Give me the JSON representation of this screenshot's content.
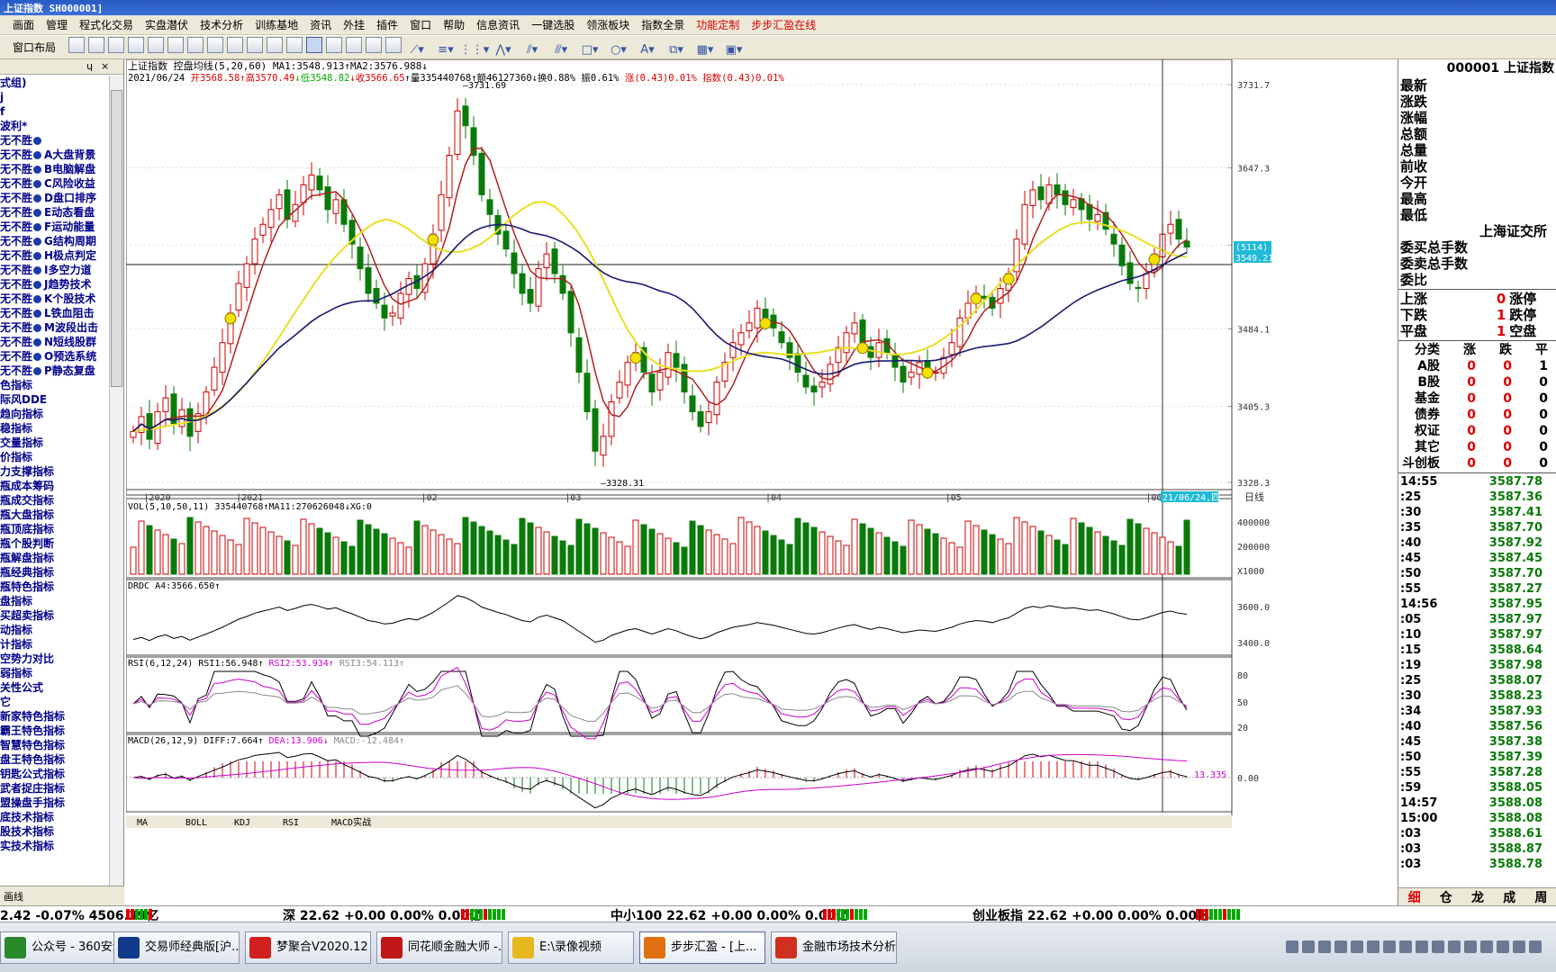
{
  "title": "上证指数 SH000001]",
  "menu": [
    "画面",
    "管理",
    "程式化交易",
    "实盘潜伏",
    "技术分析",
    "训练基地",
    "资讯",
    "外挂",
    "插件",
    "窗口",
    "帮助",
    "信息资讯",
    "一键选股",
    "领涨板块",
    "指数全景",
    "功能定制",
    "步步汇盈在线"
  ],
  "menu_red": [
    "功能定制",
    "步步汇盈在线"
  ],
  "toolbar": {
    "window_layout": "窗口布局"
  },
  "left": {
    "header_pin": "ɥ",
    "header_close": "×",
    "items": [
      {
        "t": "式组)"
      },
      {
        "t": "j"
      },
      {
        "t": "f"
      },
      {
        "t": "波利*"
      },
      {
        "t": "无不胜",
        "dot": true,
        "x": ""
      },
      {
        "t": "无不胜",
        "dot": true,
        "x": "A大盘背景"
      },
      {
        "t": "无不胜",
        "dot": true,
        "x": "B电脑解盘"
      },
      {
        "t": "无不胜",
        "dot": true,
        "x": "C风险收益"
      },
      {
        "t": "无不胜",
        "dot": true,
        "x": "D盘口排序"
      },
      {
        "t": "无不胜",
        "dot": true,
        "x": "E动态看盘"
      },
      {
        "t": "无不胜",
        "dot": true,
        "x": "F运动能量"
      },
      {
        "t": "无不胜",
        "dot": true,
        "x": "G结构周期"
      },
      {
        "t": "无不胜",
        "dot": true,
        "x": "H极点判定"
      },
      {
        "t": "无不胜",
        "dot": true,
        "x": "I多空力道"
      },
      {
        "t": "无不胜",
        "dot": true,
        "x": "J趋势技术"
      },
      {
        "t": "无不胜",
        "dot": true,
        "x": "K个股技术"
      },
      {
        "t": "无不胜",
        "dot": true,
        "x": "L铁血阻击"
      },
      {
        "t": "无不胜",
        "dot": true,
        "x": "M波段出击"
      },
      {
        "t": "无不胜",
        "dot": true,
        "x": "N短线股群"
      },
      {
        "t": "无不胜",
        "dot": true,
        "x": "O预选系统"
      },
      {
        "t": "无不胜",
        "dot": true,
        "x": "P静态复盘"
      },
      {
        "t": "色指标"
      },
      {
        "t": "际风DDE"
      },
      {
        "t": "趋向指标"
      },
      {
        "t": "稳指标"
      },
      {
        "t": "交量指标"
      },
      {
        "t": "价指标"
      },
      {
        "t": "力支撑指标"
      },
      {
        "t": "瓶成本筹码"
      },
      {
        "t": "瓶成交指标"
      },
      {
        "t": "瓶大盘指标"
      },
      {
        "t": "瓶顶底指标"
      },
      {
        "t": "瓶个股判断"
      },
      {
        "t": "瓶解盘指标"
      },
      {
        "t": "瓶经典指标"
      },
      {
        "t": "瓶特色指标"
      },
      {
        "t": "盘指标"
      },
      {
        "t": "买超卖指标"
      },
      {
        "t": "动指标"
      },
      {
        "t": "计指标"
      },
      {
        "t": "空势力对比"
      },
      {
        "t": "弱指标"
      },
      {
        "t": "关性公式"
      },
      {
        "t": "它"
      },
      {
        "t": "新家特色指标"
      },
      {
        "t": "霸王特色指标"
      },
      {
        "t": "智慧特色指标"
      },
      {
        "t": "盘王特色指标"
      },
      {
        "t": "钥匙公式指标"
      },
      {
        "t": "武者捉庄指标"
      },
      {
        "t": "盟操盘手指标"
      },
      {
        "t": "底技术指标"
      },
      {
        "t": "股技术指标"
      },
      {
        "t": "实技术指标"
      }
    ],
    "bottom_tab": "画线"
  },
  "chart": {
    "header1": "上证指数  控盘均线(5,20,60) MA1:3548.913↑MA2:3576.988↓",
    "header2_date": "2021/06/24",
    "header2_open": "开3568.58",
    "header2_high": "↑高3570.49",
    "header2_low": "↓低3548.82",
    "header2_close": "↓收3566.65",
    "header2_vol": "↑量335440768↑额46127360↓换0.88% 振0.61%",
    "header2_chg": "涨(0.43)0.01%",
    "header2_idx": "指数(0.43)0.01%",
    "peak_label": "3731.69",
    "trough_label": "3328.31",
    "yticks": [
      "3731.7",
      "3647.3",
      "3568.8",
      "3484.1",
      "3405.3",
      "3328.3"
    ],
    "yfoot": "日线",
    "y_pointer_1": "(5114)",
    "y_pointer_2": "3549.21",
    "xticks": [
      "2020",
      "2021",
      "02",
      "03",
      "04",
      "05",
      "06"
    ],
    "cursor_date": "21/06/24,四",
    "vol_header": "VOL(5,10,50,11) 335440768↑MA11:270626048↓XG:0",
    "vol_ticks": [
      "400000",
      "200000",
      "X1000"
    ],
    "drdc_header": "DRDC A4:3566.650↑",
    "drdc_ticks": [
      "3600.0",
      "3400.0"
    ],
    "rsi_header": "RSI(6,12,24) RSI1:56.948↑",
    "rsi2": "RSI2:53.934↑",
    "rsi3": "RSI3:54.113↑",
    "rsi_ticks": [
      "80",
      "50",
      "20"
    ],
    "macd_header": "MACD(26,12,9) DIFF:7.664↑",
    "macd_dea": "DEA:13.906↓",
    "macd_val": "MACD:-12.484↑",
    "macd_ticks": [
      "13.335",
      "0.00"
    ],
    "tabs": [
      "MA",
      "BOLL",
      "KDJ",
      "RSI",
      "MACD实战"
    ]
  },
  "chart_data": {
    "type": "candlestick",
    "title": "上证指数 2020-12 ~ 2021-06-24",
    "indicators": [
      "控盘均线(5,20,60)",
      "VOL(5,10,50,11)",
      "DRDC",
      "RSI(6,12,24)",
      "MACD(26,12,9)"
    ],
    "ylim": [
      3328.3,
      3731.7
    ],
    "last_bar": {
      "date": "2021/06/24",
      "open": 3568.58,
      "high": 3570.49,
      "low": 3548.82,
      "close": 3566.65,
      "volume": 335440768
    },
    "high_mark": 3731.69,
    "low_mark": 3328.31,
    "closes": [
      3380,
      3395,
      3372,
      3400,
      3414,
      3388,
      3402,
      3375,
      3398,
      3420,
      3445,
      3470,
      3500,
      3530,
      3550,
      3575,
      3590,
      3605,
      3620,
      3595,
      3610,
      3630,
      3640,
      3625,
      3605,
      3615,
      3590,
      3570,
      3545,
      3520,
      3510,
      3495,
      3500,
      3520,
      3535,
      3525,
      3550,
      3580,
      3620,
      3660,
      3705,
      3690,
      3660,
      3620,
      3600,
      3580,
      3565,
      3540,
      3520,
      3510,
      3545,
      3560,
      3540,
      3520,
      3480,
      3440,
      3400,
      3360,
      3375,
      3410,
      3430,
      3450,
      3460,
      3440,
      3420,
      3440,
      3460,
      3445,
      3420,
      3400,
      3385,
      3400,
      3430,
      3450,
      3470,
      3480,
      3490,
      3505,
      3495,
      3485,
      3470,
      3455,
      3440,
      3425,
      3420,
      3430,
      3448,
      3465,
      3480,
      3490,
      3470,
      3455,
      3470,
      3460,
      3445,
      3430,
      3440,
      3450,
      3445,
      3440,
      3455,
      3470,
      3495,
      3510,
      3520,
      3515,
      3505,
      3525,
      3540,
      3575,
      3610,
      3625,
      3615,
      3630,
      3620,
      3610,
      3615,
      3605,
      3595,
      3600,
      3585,
      3570,
      3548,
      3530,
      3525,
      3540,
      3560,
      3580,
      3590,
      3575,
      3567
    ],
    "ma20": [
      3380,
      3382,
      3383,
      3385,
      3387,
      3389,
      3392,
      3396,
      3402,
      3410,
      3420,
      3432,
      3446,
      3462,
      3478,
      3495,
      3511,
      3527,
      3542,
      3555,
      3566,
      3576,
      3585,
      3592,
      3595,
      3592,
      3586,
      3578,
      3570,
      3565,
      3562,
      3562,
      3565,
      3570,
      3578,
      3588,
      3598,
      3606,
      3612,
      3613,
      3608,
      3598,
      3585,
      3568,
      3548,
      3525,
      3502,
      3482,
      3466,
      3454,
      3447,
      3444,
      3442,
      3441,
      3441,
      3443,
      3447,
      3452,
      3456,
      3459,
      3460,
      3459,
      3458,
      3458,
      3459,
      3460,
      3462,
      3464,
      3465,
      3464,
      3462,
      3460,
      3458,
      3458,
      3460,
      3463,
      3468,
      3475,
      3483,
      3492,
      3503,
      3515,
      3527,
      3539,
      3550,
      3560,
      3570,
      3578,
      3585,
      3590,
      3592,
      3592,
      3590,
      3587,
      3583,
      3578,
      3572,
      3567,
      3562,
      3558,
      3557
    ]
  },
  "right": {
    "code": "000001 上证指数",
    "labels": [
      "最新",
      "涨跌",
      "涨幅",
      "总额",
      "总量",
      "前收",
      "今开",
      "最高",
      "最低"
    ],
    "exchange": "上海证交所",
    "bid_labels": [
      "委买总手数",
      "委卖总手数",
      "委比"
    ],
    "rows3": [
      {
        "a": "上涨",
        "b": "0",
        "c": "涨停"
      },
      {
        "a": "下跌",
        "b": "1",
        "c": "跌停"
      },
      {
        "a": "平盘",
        "b": "1",
        "c": "空盘"
      }
    ],
    "cls_head": [
      "分类",
      "涨",
      "跌",
      "平"
    ],
    "cls": [
      {
        "n": "A股",
        "u": "0",
        "d": "0",
        "f": "1"
      },
      {
        "n": "B股",
        "u": "0",
        "d": "0",
        "f": "0"
      },
      {
        "n": "基金",
        "u": "0",
        "d": "0",
        "f": "0"
      },
      {
        "n": "债券",
        "u": "0",
        "d": "0",
        "f": "0"
      },
      {
        "n": "权证",
        "u": "0",
        "d": "0",
        "f": "0"
      },
      {
        "n": "其它",
        "u": "0",
        "d": "0",
        "f": "0"
      },
      {
        "n": "斗创板",
        "u": "0",
        "d": "0",
        "f": "0"
      }
    ],
    "ticks": [
      {
        "t": "14:55",
        "p": "3587.78"
      },
      {
        "t": ":25",
        "p": "3587.36"
      },
      {
        "t": ":30",
        "p": "3587.41"
      },
      {
        "t": ":35",
        "p": "3587.70"
      },
      {
        "t": ":40",
        "p": "3587.92"
      },
      {
        "t": ":45",
        "p": "3587.45"
      },
      {
        "t": ":50",
        "p": "3587.70"
      },
      {
        "t": ":55",
        "p": "3587.27"
      },
      {
        "t": "14:56",
        "p": "3587.95"
      },
      {
        "t": ":05",
        "p": "3587.97"
      },
      {
        "t": ":10",
        "p": "3587.97"
      },
      {
        "t": ":15",
        "p": "3588.64"
      },
      {
        "t": ":19",
        "p": "3587.98"
      },
      {
        "t": ":25",
        "p": "3588.07"
      },
      {
        "t": ":30",
        "p": "3588.23"
      },
      {
        "t": ":34",
        "p": "3587.93"
      },
      {
        "t": ":40",
        "p": "3587.56"
      },
      {
        "t": ":45",
        "p": "3587.38"
      },
      {
        "t": ":50",
        "p": "3587.39"
      },
      {
        "t": ":55",
        "p": "3587.28"
      },
      {
        "t": ":59",
        "p": "3588.05"
      },
      {
        "t": "14:57",
        "p": "3588.08"
      },
      {
        "t": "15:00",
        "p": "3588.08"
      },
      {
        "t": ":03",
        "p": "3588.61"
      },
      {
        "t": ":03",
        "p": "3588.87"
      },
      {
        "t": ":03",
        "p": "3588.78"
      }
    ],
    "tabs": [
      "细",
      "仓",
      "龙",
      "成",
      "周"
    ]
  },
  "status": {
    "s1": "2.42 -0.07% 4506.39亿",
    "s2": "深 22.62 +0.00 0.00% 0.00亿",
    "s3": "中小100 22.62 +0.00 0.00% 0.00亿",
    "s4": "创业板指 22.62 +0.00 0.00% 0.00亿"
  },
  "taskbar": [
    {
      "label": "公众号 - 360安全...",
      "color": "#2a8a2a"
    },
    {
      "label": "交易师经典版[沪...",
      "color": "#123a8a"
    },
    {
      "label": "梦聚合V2020.12 -...",
      "color": "#d02020"
    },
    {
      "label": "同花顺金融大师 -...",
      "color": "#c01818"
    },
    {
      "label": "E:\\录像视频",
      "color": "#e8b820"
    },
    {
      "label": "步步汇盈 - [上...",
      "color": "#e07010"
    },
    {
      "label": "金融市场技术分析...",
      "color": "#d03020"
    }
  ]
}
